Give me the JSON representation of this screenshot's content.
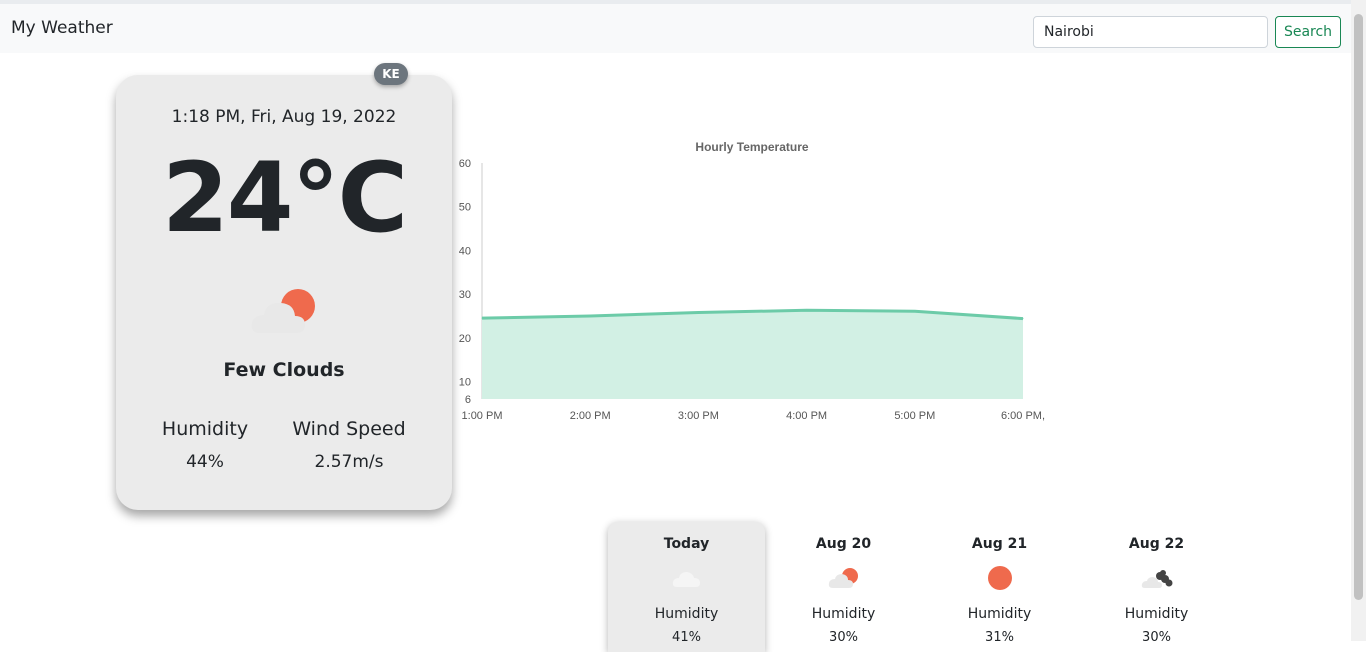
{
  "app": {
    "title": "My Weather"
  },
  "search": {
    "value": "Nairobi",
    "button_label": "Search"
  },
  "current": {
    "country": "KE",
    "datetime": "1:18 PM, Fri, Aug 19, 2022",
    "temperature": "24°C",
    "condition": "Few Clouds",
    "condition_icon": "cloud-sun-icon",
    "humidity_label": "Humidity",
    "humidity": "44%",
    "wind_label": "Wind Speed",
    "wind": "2.57m/s"
  },
  "colors": {
    "accent": "#198754",
    "sun": "#ef6a4d",
    "cloud": "#e8e8e8",
    "line": "#6ccba8",
    "area": "#d2f0e4"
  },
  "chart_data": {
    "type": "area",
    "title": "Hourly Temperature",
    "x": [
      "1:00 PM",
      "2:00 PM",
      "3:00 PM",
      "4:00 PM",
      "5:00 PM",
      "6:00 PM,"
    ],
    "values": [
      24.5,
      25,
      25.8,
      26.3,
      26.1,
      24.4
    ],
    "yticks": [
      6,
      10,
      20,
      30,
      40,
      50,
      60
    ],
    "ylim": [
      6,
      60
    ]
  },
  "forecast": [
    {
      "day": "Today",
      "icon": "cloud-icon",
      "humidity_label": "Humidity",
      "humidity": "41%"
    },
    {
      "day": "Aug 20",
      "icon": "cloud-sun-icon",
      "humidity_label": "Humidity",
      "humidity": "30%"
    },
    {
      "day": "Aug 21",
      "icon": "sun-icon",
      "humidity_label": "Humidity",
      "humidity": "31%"
    },
    {
      "day": "Aug 22",
      "icon": "dark-clouds-icon",
      "humidity_label": "Humidity",
      "humidity": "30%"
    }
  ]
}
